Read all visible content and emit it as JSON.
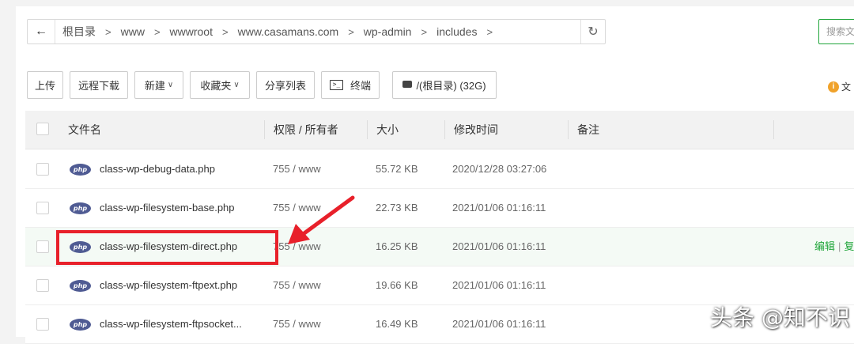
{
  "breadcrumb": {
    "back_label": "←",
    "items": [
      "根目录",
      "www",
      "wwwroot",
      "www.casamans.com",
      "wp-admin",
      "includes"
    ],
    "separator": ">",
    "refresh_icon": "↻"
  },
  "search": {
    "placeholder": "搜索文"
  },
  "toolbar": {
    "upload": "上传",
    "remote_download": "远程下载",
    "new": "新建",
    "favorites": "收藏夹",
    "share_list": "分享列表",
    "terminal": "终端",
    "terminal_icon": ">_",
    "disk": "/(根目录) (32G)",
    "tip_icon": "i",
    "tip_text": "文"
  },
  "table": {
    "headers": {
      "name": "文件名",
      "perm": "权限 / 所有者",
      "size": "大小",
      "mtime": "修改时间",
      "note": "备注"
    },
    "file_icon_text": "php",
    "rows": [
      {
        "name": "class-wp-debug-data.php",
        "perm": "755 / www",
        "size": "55.72 KB",
        "mtime": "2020/12/28 03:27:06"
      },
      {
        "name": "class-wp-filesystem-base.php",
        "perm": "755 / www",
        "size": "22.73 KB",
        "mtime": "2021/01/06 01:16:11"
      },
      {
        "name": "class-wp-filesystem-direct.php",
        "perm": "755 / www",
        "size": "16.25 KB",
        "mtime": "2021/01/06 01:16:11",
        "op_edit": "编辑",
        "op_sep": "|",
        "op_copy": "复"
      },
      {
        "name": "class-wp-filesystem-ftpext.php",
        "perm": "755 / www",
        "size": "19.66 KB",
        "mtime": "2021/01/06 01:16:11"
      },
      {
        "name": "class-wp-filesystem-ftpsocket...",
        "perm": "755 / www",
        "size": "16.49 KB",
        "mtime": "2021/01/06 01:16:11"
      }
    ]
  },
  "watermark": "头条 @知不识",
  "colors": {
    "accent": "#20a53a",
    "annotation": "#e8202a",
    "php_icon": "#4f5b93"
  }
}
